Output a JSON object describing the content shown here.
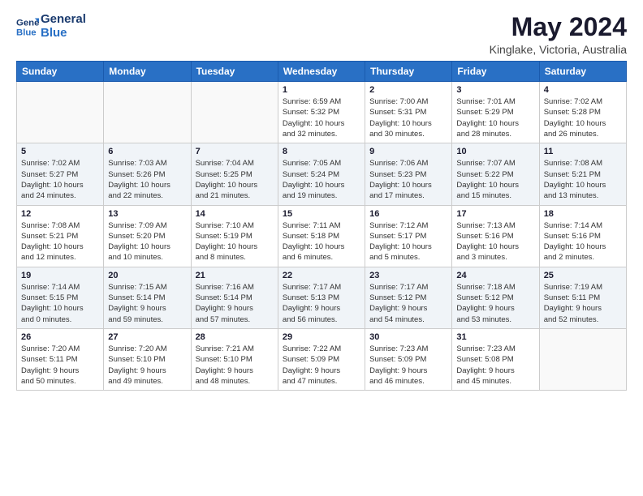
{
  "logo": {
    "line1": "General",
    "line2": "Blue"
  },
  "title": "May 2024",
  "subtitle": "Kinglake, Victoria, Australia",
  "weekdays": [
    "Sunday",
    "Monday",
    "Tuesday",
    "Wednesday",
    "Thursday",
    "Friday",
    "Saturday"
  ],
  "weeks": [
    [
      {
        "day": "",
        "info": ""
      },
      {
        "day": "",
        "info": ""
      },
      {
        "day": "",
        "info": ""
      },
      {
        "day": "1",
        "info": "Sunrise: 6:59 AM\nSunset: 5:32 PM\nDaylight: 10 hours\nand 32 minutes."
      },
      {
        "day": "2",
        "info": "Sunrise: 7:00 AM\nSunset: 5:31 PM\nDaylight: 10 hours\nand 30 minutes."
      },
      {
        "day": "3",
        "info": "Sunrise: 7:01 AM\nSunset: 5:29 PM\nDaylight: 10 hours\nand 28 minutes."
      },
      {
        "day": "4",
        "info": "Sunrise: 7:02 AM\nSunset: 5:28 PM\nDaylight: 10 hours\nand 26 minutes."
      }
    ],
    [
      {
        "day": "5",
        "info": "Sunrise: 7:02 AM\nSunset: 5:27 PM\nDaylight: 10 hours\nand 24 minutes."
      },
      {
        "day": "6",
        "info": "Sunrise: 7:03 AM\nSunset: 5:26 PM\nDaylight: 10 hours\nand 22 minutes."
      },
      {
        "day": "7",
        "info": "Sunrise: 7:04 AM\nSunset: 5:25 PM\nDaylight: 10 hours\nand 21 minutes."
      },
      {
        "day": "8",
        "info": "Sunrise: 7:05 AM\nSunset: 5:24 PM\nDaylight: 10 hours\nand 19 minutes."
      },
      {
        "day": "9",
        "info": "Sunrise: 7:06 AM\nSunset: 5:23 PM\nDaylight: 10 hours\nand 17 minutes."
      },
      {
        "day": "10",
        "info": "Sunrise: 7:07 AM\nSunset: 5:22 PM\nDaylight: 10 hours\nand 15 minutes."
      },
      {
        "day": "11",
        "info": "Sunrise: 7:08 AM\nSunset: 5:21 PM\nDaylight: 10 hours\nand 13 minutes."
      }
    ],
    [
      {
        "day": "12",
        "info": "Sunrise: 7:08 AM\nSunset: 5:21 PM\nDaylight: 10 hours\nand 12 minutes."
      },
      {
        "day": "13",
        "info": "Sunrise: 7:09 AM\nSunset: 5:20 PM\nDaylight: 10 hours\nand 10 minutes."
      },
      {
        "day": "14",
        "info": "Sunrise: 7:10 AM\nSunset: 5:19 PM\nDaylight: 10 hours\nand 8 minutes."
      },
      {
        "day": "15",
        "info": "Sunrise: 7:11 AM\nSunset: 5:18 PM\nDaylight: 10 hours\nand 6 minutes."
      },
      {
        "day": "16",
        "info": "Sunrise: 7:12 AM\nSunset: 5:17 PM\nDaylight: 10 hours\nand 5 minutes."
      },
      {
        "day": "17",
        "info": "Sunrise: 7:13 AM\nSunset: 5:16 PM\nDaylight: 10 hours\nand 3 minutes."
      },
      {
        "day": "18",
        "info": "Sunrise: 7:14 AM\nSunset: 5:16 PM\nDaylight: 10 hours\nand 2 minutes."
      }
    ],
    [
      {
        "day": "19",
        "info": "Sunrise: 7:14 AM\nSunset: 5:15 PM\nDaylight: 10 hours\nand 0 minutes."
      },
      {
        "day": "20",
        "info": "Sunrise: 7:15 AM\nSunset: 5:14 PM\nDaylight: 9 hours\nand 59 minutes."
      },
      {
        "day": "21",
        "info": "Sunrise: 7:16 AM\nSunset: 5:14 PM\nDaylight: 9 hours\nand 57 minutes."
      },
      {
        "day": "22",
        "info": "Sunrise: 7:17 AM\nSunset: 5:13 PM\nDaylight: 9 hours\nand 56 minutes."
      },
      {
        "day": "23",
        "info": "Sunrise: 7:17 AM\nSunset: 5:12 PM\nDaylight: 9 hours\nand 54 minutes."
      },
      {
        "day": "24",
        "info": "Sunrise: 7:18 AM\nSunset: 5:12 PM\nDaylight: 9 hours\nand 53 minutes."
      },
      {
        "day": "25",
        "info": "Sunrise: 7:19 AM\nSunset: 5:11 PM\nDaylight: 9 hours\nand 52 minutes."
      }
    ],
    [
      {
        "day": "26",
        "info": "Sunrise: 7:20 AM\nSunset: 5:11 PM\nDaylight: 9 hours\nand 50 minutes."
      },
      {
        "day": "27",
        "info": "Sunrise: 7:20 AM\nSunset: 5:10 PM\nDaylight: 9 hours\nand 49 minutes."
      },
      {
        "day": "28",
        "info": "Sunrise: 7:21 AM\nSunset: 5:10 PM\nDaylight: 9 hours\nand 48 minutes."
      },
      {
        "day": "29",
        "info": "Sunrise: 7:22 AM\nSunset: 5:09 PM\nDaylight: 9 hours\nand 47 minutes."
      },
      {
        "day": "30",
        "info": "Sunrise: 7:23 AM\nSunset: 5:09 PM\nDaylight: 9 hours\nand 46 minutes."
      },
      {
        "day": "31",
        "info": "Sunrise: 7:23 AM\nSunset: 5:08 PM\nDaylight: 9 hours\nand 45 minutes."
      },
      {
        "day": "",
        "info": ""
      }
    ]
  ]
}
